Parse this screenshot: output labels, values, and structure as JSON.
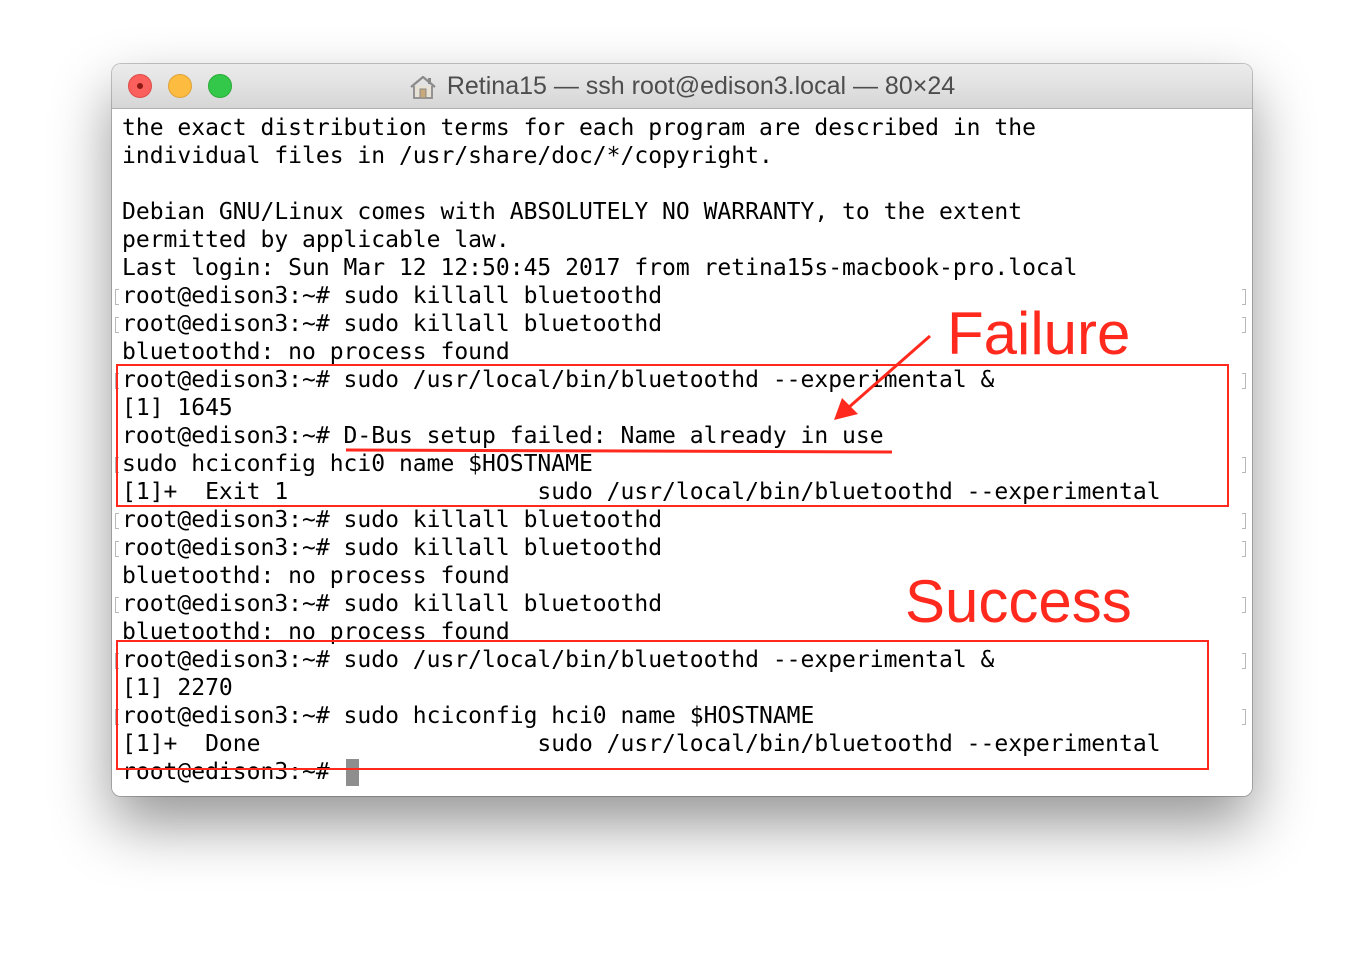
{
  "window": {
    "title": "Retina15 — ssh root@edison3.local — 80×24",
    "title_icon": "home-icon",
    "buttons": {
      "close": "close-button",
      "minimize": "minimize-button",
      "zoom": "zoom-button"
    },
    "colors": {
      "close": "#fc605c",
      "minimize": "#fdbc40",
      "zoom": "#34c84a"
    }
  },
  "terminal": {
    "lines": [
      "the exact distribution terms for each program are described in the",
      "individual files in /usr/share/doc/*/copyright.",
      "",
      "Debian GNU/Linux comes with ABSOLUTELY NO WARRANTY, to the extent",
      "permitted by applicable law.",
      "Last login: Sun Mar 12 12:50:45 2017 from retina15s-macbook-pro.local",
      "root@edison3:~# sudo killall bluetoothd",
      "root@edison3:~# sudo killall bluetoothd",
      "bluetoothd: no process found",
      "root@edison3:~# sudo /usr/local/bin/bluetoothd --experimental &",
      "[1] 1645",
      "root@edison3:~# D-Bus setup failed: Name already in use",
      "sudo hciconfig hci0 name $HOSTNAME",
      "[1]+  Exit 1                  sudo /usr/local/bin/bluetoothd --experimental",
      "root@edison3:~# sudo killall bluetoothd",
      "root@edison3:~# sudo killall bluetoothd",
      "bluetoothd: no process found",
      "root@edison3:~# sudo killall bluetoothd",
      "bluetoothd: no process found",
      "root@edison3:~# sudo /usr/local/bin/bluetoothd --experimental &",
      "[1] 2270",
      "root@edison3:~# sudo hciconfig hci0 name $HOSTNAME",
      "[1]+  Done                    sudo /usr/local/bin/bluetoothd --experimental",
      "root@edison3:~# "
    ]
  },
  "annotations": {
    "failure_label": "Failure",
    "success_label": "Success",
    "color": "#ff2a1d"
  }
}
